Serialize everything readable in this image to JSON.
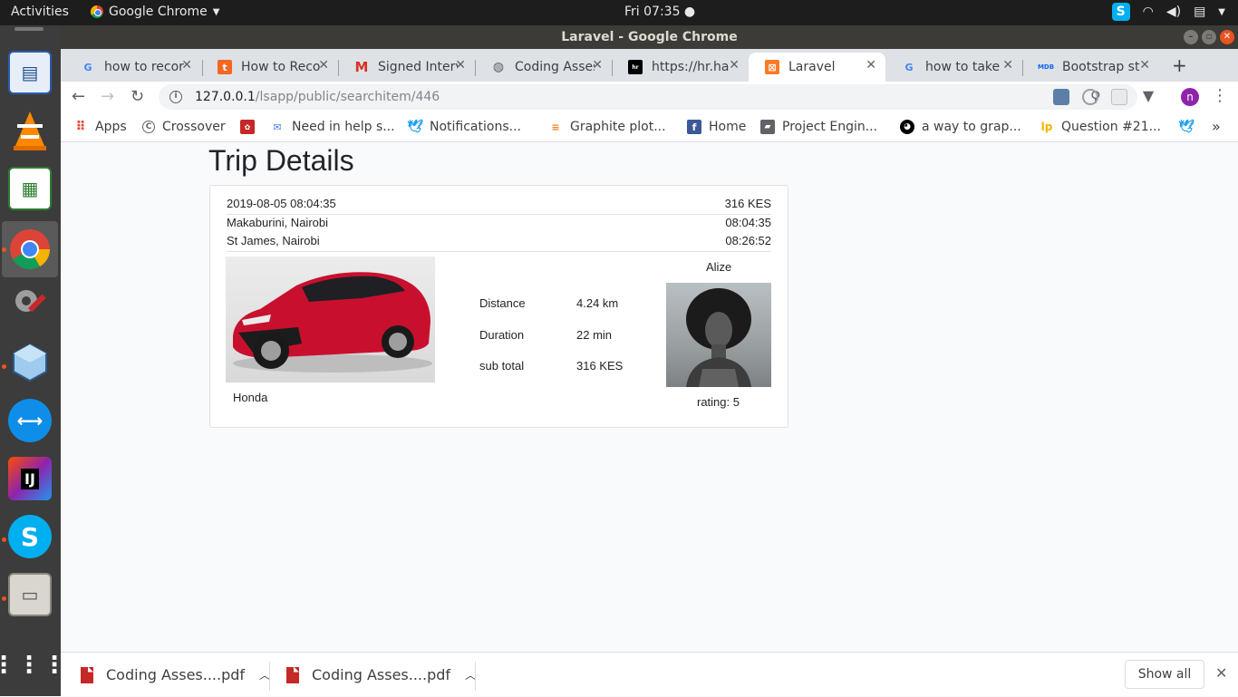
{
  "topbar": {
    "activities": "Activities",
    "app_name": "Google Chrome",
    "clock": "Fri 07:35"
  },
  "window": {
    "title": "Laravel - Google Chrome"
  },
  "tabs": [
    {
      "label": "how to recor",
      "icon": "google-icon"
    },
    {
      "label": "How to Reco",
      "icon": "t-icon"
    },
    {
      "label": "Signed Interv",
      "icon": "gmail-icon"
    },
    {
      "label": "Coding Asses",
      "icon": "globe-icon"
    },
    {
      "label": "https://hr.ha",
      "icon": "hackerrank-icon"
    },
    {
      "label": "Laravel",
      "icon": "xampp-icon"
    },
    {
      "label": "how to take",
      "icon": "google-icon"
    },
    {
      "label": "Bootstrap st",
      "icon": "mdb-icon"
    }
  ],
  "address_bar": {
    "host": "127.0.0.1",
    "path": "/lsapp/public/searchitem/446"
  },
  "profile_initial": "n",
  "bookmarks": [
    {
      "label": "Apps"
    },
    {
      "label": "Crossover"
    },
    {
      "label": ""
    },
    {
      "label": "Need in help s..."
    },
    {
      "label": "Notifications..."
    },
    {
      "label": "Graphite plot..."
    },
    {
      "label": "Home"
    },
    {
      "label": "Project Engin..."
    },
    {
      "label": "a way to grap..."
    },
    {
      "label": "Question #21..."
    }
  ],
  "page": {
    "title": "Trip Details",
    "trip": {
      "datetime": "2019-08-05 08:04:35",
      "fare": "316 KES",
      "pickup": "Makaburini, Nairobi",
      "pickup_time": "08:04:35",
      "dropoff": "St James, Nairobi",
      "dropoff_time": "08:26:52",
      "car": "Honda",
      "stats": [
        {
          "label": "Distance",
          "value": "4.24 km"
        },
        {
          "label": "Duration",
          "value": "22 min"
        },
        {
          "label": "sub total",
          "value": "316 KES"
        }
      ],
      "driver_name": "Alize",
      "driver_rating": "rating: 5"
    }
  },
  "downloads": [
    {
      "label": "Coding Asses....pdf"
    },
    {
      "label": "Coding Asses....pdf"
    }
  ],
  "show_all": "Show all"
}
